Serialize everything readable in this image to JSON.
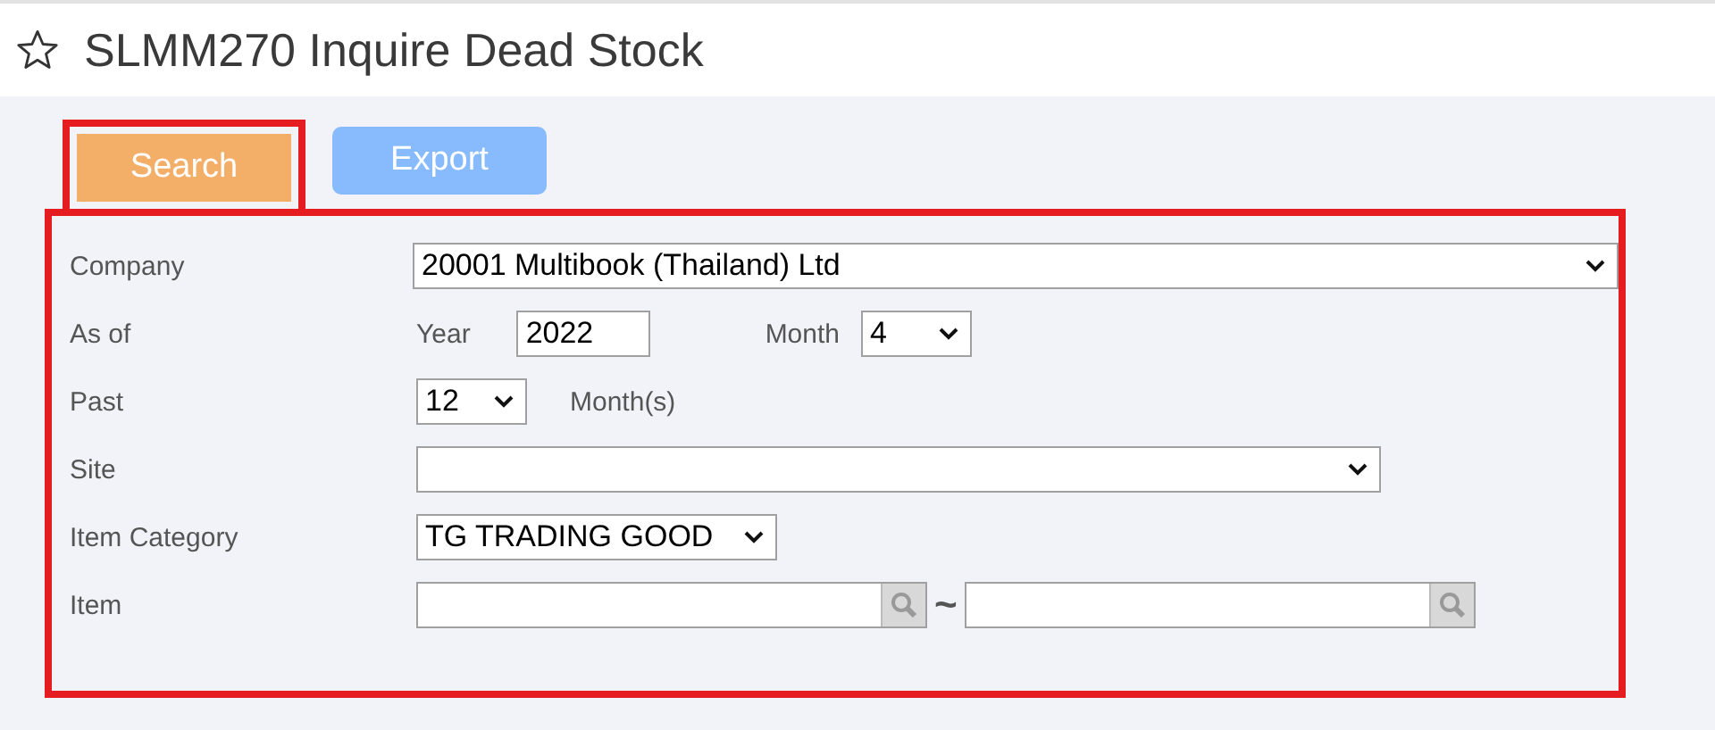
{
  "window": {
    "title": "SLMM270 Inquire Dead Stock",
    "favorite": false
  },
  "buttons": [
    {
      "label": "Search",
      "kind": "primary",
      "highlighted": true
    },
    {
      "label": "Export",
      "kind": "secondary",
      "highlighted": false
    }
  ],
  "form": {
    "highlighted": true,
    "rows": [
      {
        "label": "Company",
        "kind": "wide-select",
        "value": "20001 Multibook (Thailand) Ltd"
      },
      {
        "label": "As of",
        "kind": "year-month",
        "year_label": "Year",
        "year": "2022",
        "month_label": "Month",
        "month": "4"
      },
      {
        "label": "Past",
        "kind": "period",
        "value": "12",
        "unit": "Month(s)"
      },
      {
        "label": "Site",
        "kind": "medium-select"
      },
      {
        "label": "Item Category",
        "kind": "short-select",
        "value": "TG TRADING GOOD"
      },
      {
        "label": "Item",
        "kind": "range",
        "separator": "~"
      }
    ]
  }
}
